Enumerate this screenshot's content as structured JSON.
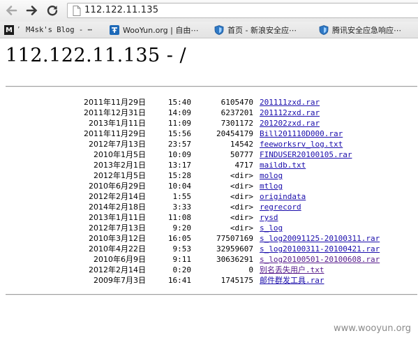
{
  "browser": {
    "url": "112.122.11.135",
    "bookmarks": [
      {
        "label": "M4sk's Blog - ⋯",
        "icon": "m-site-icon"
      },
      {
        "label": "WooYun.org | 自由⋯",
        "icon": "wooyun-icon"
      },
      {
        "label": "首页 - 新浪安全应⋯",
        "icon": "shield-icon"
      },
      {
        "label": "腾讯安全应急响应⋯",
        "icon": "shield-icon"
      }
    ]
  },
  "page": {
    "heading": "112.122.11.135 - /",
    "entries": [
      {
        "date": "2011年11月29日",
        "time": "15:40",
        "size": "6105470",
        "name": "201111zxd.rar"
      },
      {
        "date": "2011年12月31日",
        "time": "14:09",
        "size": "6237201",
        "name": "201112zxd.rar"
      },
      {
        "date": "2013年1月11日",
        "time": "11:09",
        "size": "7301172",
        "name": "201202zxd.rar"
      },
      {
        "date": "2011年11月29日",
        "time": "15:56",
        "size": "20454179",
        "name": "Bill201110D000.rar"
      },
      {
        "date": "2012年7月13日",
        "time": "23:57",
        "size": "14542",
        "name": "feeworksrv_log.txt"
      },
      {
        "date": "2010年1月5日",
        "time": "10:09",
        "size": "50777",
        "name": "FINDUSER20100105.rar"
      },
      {
        "date": "2013年2月1日",
        "time": "13:17",
        "size": "4717",
        "name": "maildb.txt"
      },
      {
        "date": "2012年1月5日",
        "time": "15:28",
        "size": "<dir>",
        "name": "molog"
      },
      {
        "date": "2010年6月29日",
        "time": "10:04",
        "size": "<dir>",
        "name": "mtlog"
      },
      {
        "date": "2012年2月14日",
        "time": "1:55",
        "size": "<dir>",
        "name": "origindata"
      },
      {
        "date": "2014年2月18日",
        "time": "3:33",
        "size": "<dir>",
        "name": "regrecord"
      },
      {
        "date": "2013年1月11日",
        "time": "11:08",
        "size": "<dir>",
        "name": "rysd"
      },
      {
        "date": "2012年7月13日",
        "time": "9:20",
        "size": "<dir>",
        "name": "s_log"
      },
      {
        "date": "2010年3月12日",
        "time": "16:05",
        "size": "77507169",
        "name": "s_log20091125-20100311.rar"
      },
      {
        "date": "2010年4月22日",
        "time": "9:53",
        "size": "32959607",
        "name": "s_log20100311-20100421.rar"
      },
      {
        "date": "2010年6月9日",
        "time": "9:11",
        "size": "30636291",
        "name": "s_log20100501-20100608.rar"
      },
      {
        "date": "2012年2月14日",
        "time": "0:20",
        "size": "0",
        "name": "别名丢失用户.txt"
      },
      {
        "date": "2009年7月3日",
        "time": "16:41",
        "size": "1745175",
        "name": "邮件群发工具.rar"
      }
    ]
  },
  "watermark": "www.wooyun.org",
  "colors": {
    "link": "#1a0dab",
    "visited": "#551a8b",
    "watermark": "#8a8a8a"
  }
}
